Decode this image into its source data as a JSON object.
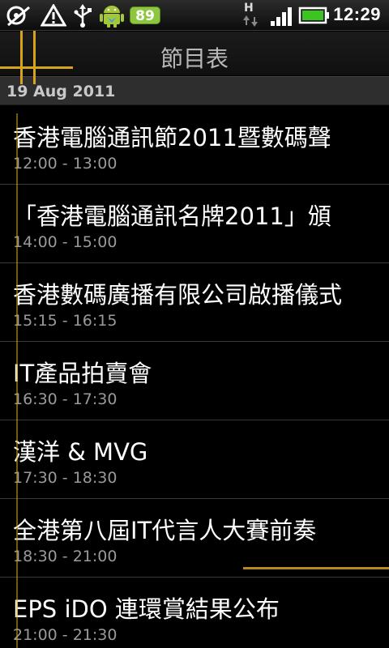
{
  "status_bar": {
    "icons": [
      "sd-card-icon",
      "warning-icon",
      "usb-icon",
      "android-robot-icon",
      "signal-icon",
      "battery-icon"
    ],
    "battery_level": "89",
    "network_type": "H",
    "time": "12:29",
    "battery_color": "#8dc63f"
  },
  "header": {
    "title": "節目表"
  },
  "date_header": "19 Aug 2011",
  "programs": [
    {
      "title": "香港電腦通訊節2011暨數碼聲",
      "time": "12:00 - 13:00"
    },
    {
      "title": "「香港電腦通訊名牌2011」頒",
      "time": "14:00 - 15:00"
    },
    {
      "title": "香港數碼廣播有限公司啟播儀式",
      "time": "15:15 - 16:15"
    },
    {
      "title": "IT產品拍賣會",
      "time": "16:30 - 17:30"
    },
    {
      "title": "漢洋 & MVG",
      "time": "17:30 - 18:30"
    },
    {
      "title": "全港第八屆IT代言人大賽前奏",
      "time": "18:30 - 21:00"
    },
    {
      "title": "EPS iDO 連環賞結果公布",
      "time": "21:00 - 21:30"
    }
  ],
  "accent_color": "#d7a31f"
}
